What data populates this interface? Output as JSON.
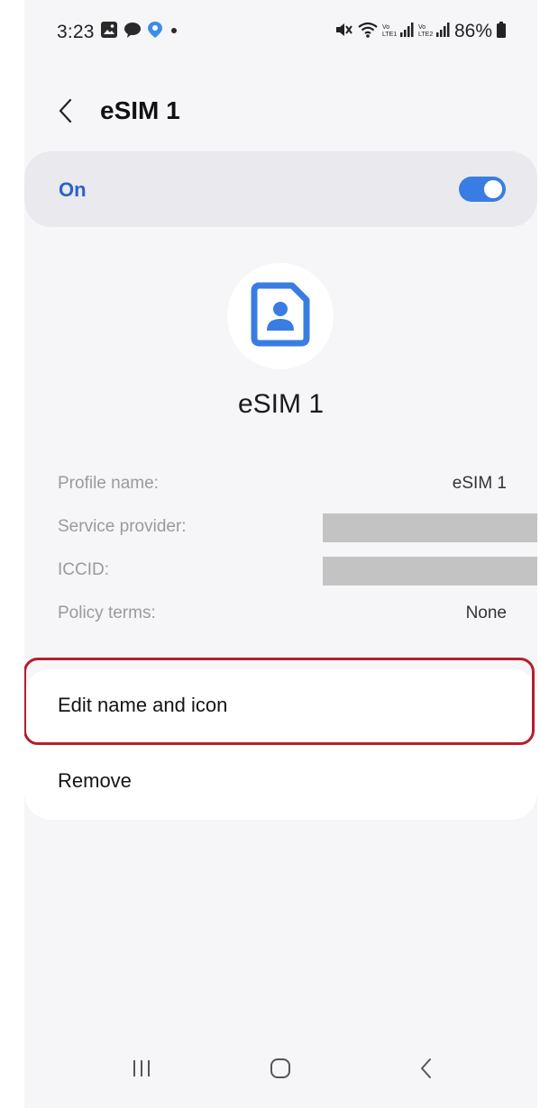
{
  "status_bar": {
    "time": "3:23",
    "battery": "86%",
    "icons": [
      "gallery-icon",
      "chat-icon",
      "location-pin-icon",
      "dot-icon",
      "mute-icon",
      "wifi-icon",
      "signal-lte1-icon",
      "signal-lte2-icon",
      "battery-icon"
    ]
  },
  "header": {
    "title": "eSIM 1",
    "back_icon": "chevron-left-icon"
  },
  "toggle": {
    "label": "On",
    "state": true,
    "accent": "#3a7de2"
  },
  "profile": {
    "title": "eSIM 1",
    "icon": "sim-card-icon",
    "icon_color": "#3a7de2"
  },
  "details": [
    {
      "label": "Profile name:",
      "value": "eSIM 1",
      "redacted": false
    },
    {
      "label": "Service provider:",
      "value": "",
      "redacted": true
    },
    {
      "label": "ICCID:",
      "value": "",
      "redacted": true
    },
    {
      "label": "Policy terms:",
      "value": "None",
      "redacted": false
    }
  ],
  "actions": [
    {
      "label": "Edit name and icon",
      "highlighted": true
    },
    {
      "label": "Remove",
      "highlighted": false
    }
  ],
  "nav": {
    "recents_icon": "recents-icon",
    "home_icon": "home-icon",
    "back_icon": "back-icon"
  },
  "colors": {
    "highlight_border": "#b51e2b",
    "toggle_card_bg": "#e9e9ee",
    "page_bg": "#f6f6f8"
  }
}
